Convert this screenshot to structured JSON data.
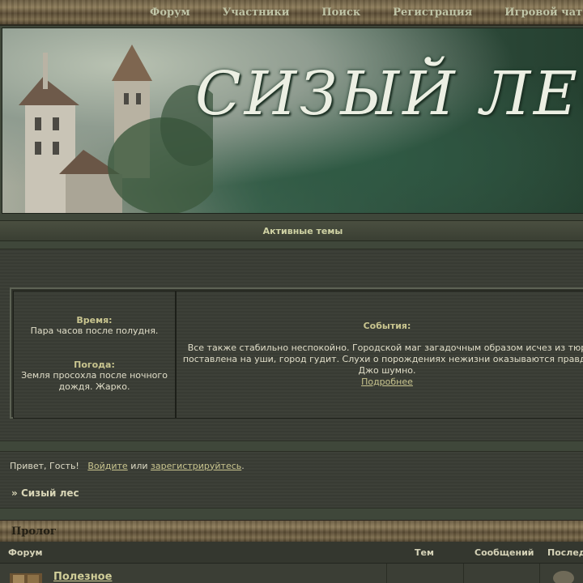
{
  "topnav": {
    "items": [
      "Форум",
      "Участники",
      "Поиск",
      "Регистрация",
      "Игровой чат"
    ]
  },
  "banner": {
    "logo_text": "СИЗЫЙ ЛЕС"
  },
  "active_topics": {
    "label": "Активные темы"
  },
  "info": {
    "time_label": "Время:",
    "time_value": "Пара часов после полудня.",
    "weather_label": "Погода:",
    "weather_value_line1": "Земля просохла после ночного",
    "weather_value_line2": "дождя. Жарко.",
    "events_label": "События:",
    "events_line1": "Все также стабильно неспокойно. Городской маг загадочным образом исчез из тюр",
    "events_line2": "поставлена на уши, город гудит. Слухи о порождениях нежизни оказываются правдо",
    "events_line3": "Джо шумно.",
    "events_more": "Подробнее"
  },
  "welcome": {
    "greeting": "Привет, Гость!",
    "login_link": "Войдите",
    "or_text": "или",
    "register_link": "зарегистрируйтесь",
    "end_punct": "."
  },
  "breadcrumb": {
    "prefix": "»",
    "title": "Сизый лес"
  },
  "category": {
    "title": "Пролог"
  },
  "columns": {
    "forum": "Форум",
    "topics": "Тем",
    "posts": "Сообщений",
    "last": "Послед"
  },
  "forum_rows": [
    {
      "title": "Полезное"
    }
  ]
}
